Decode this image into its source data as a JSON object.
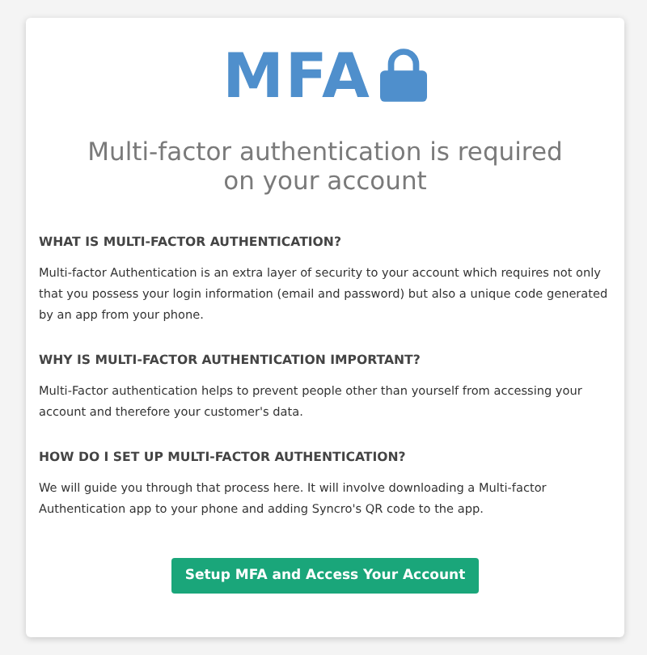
{
  "logo": {
    "text": "MFA"
  },
  "title": "Multi-factor authentication is required on your account",
  "sections": [
    {
      "heading": "WHAT IS MULTI-FACTOR AUTHENTICATION?",
      "body": "Multi-factor Authentication is an extra layer of security to your account which requires not only that you possess your login information (email and password) but also a unique code generated by an app from your phone."
    },
    {
      "heading": "WHY IS MULTI-FACTOR AUTHENTICATION IMPORTANT?",
      "body": "Multi-Factor authentication helps to prevent people other than yourself from accessing your account and therefore your customer's data."
    },
    {
      "heading": "HOW DO I SET UP MULTI-FACTOR AUTHENTICATION?",
      "body": "We will guide you through that process here. It will involve downloading a Multi-factor Authentication app to your phone and adding Syncro's QR code to the app."
    }
  ],
  "button": "Setup MFA and Access Your Account"
}
